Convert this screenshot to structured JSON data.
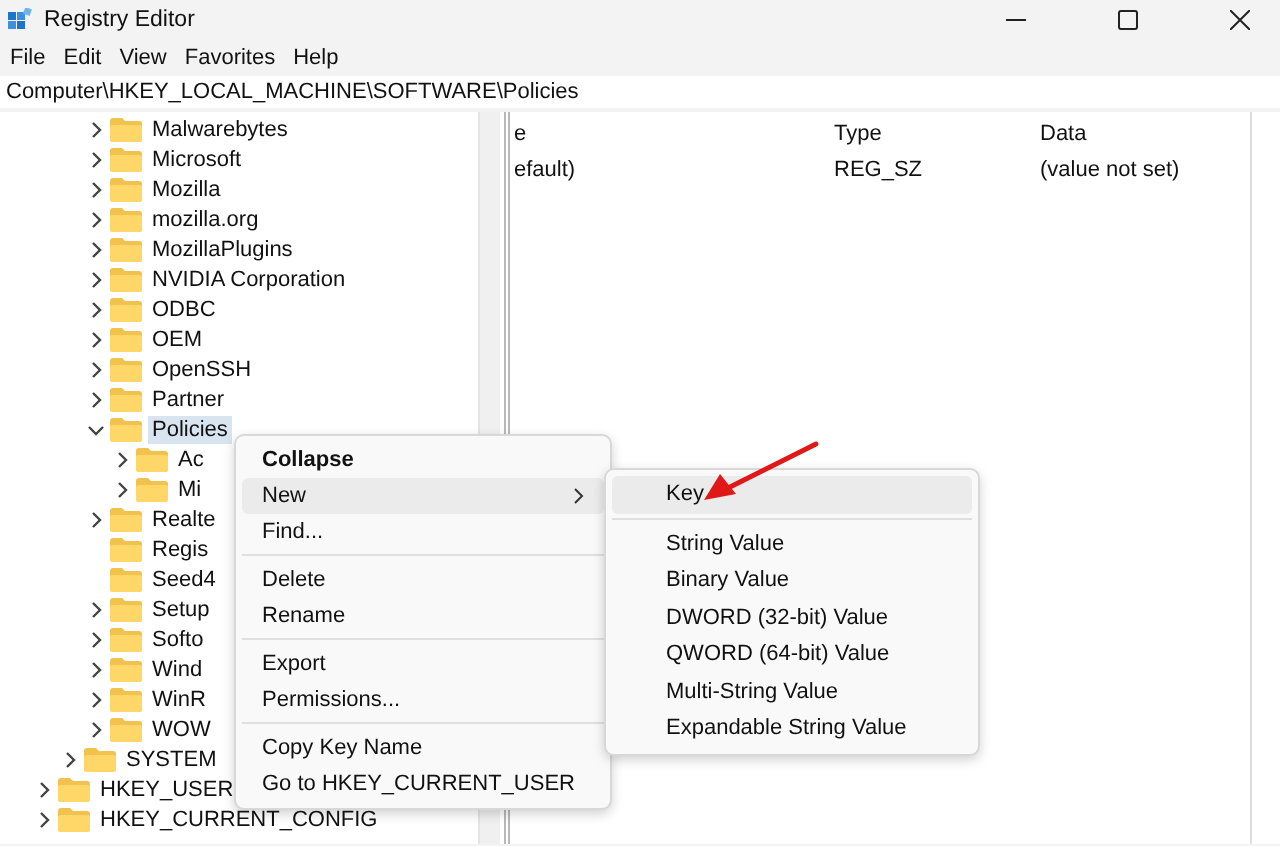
{
  "window": {
    "title": "Registry Editor"
  },
  "menu_bar": [
    "File",
    "Edit",
    "View",
    "Favorites",
    "Help"
  ],
  "address": "Computer\\HKEY_LOCAL_MACHINE\\SOFTWARE\\Policies",
  "tree": {
    "software_keys": [
      {
        "label": "Malwarebytes",
        "expanded": false,
        "leaf": false,
        "selected": false
      },
      {
        "label": "Microsoft",
        "expanded": false,
        "leaf": false,
        "selected": false
      },
      {
        "label": "Mozilla",
        "expanded": false,
        "leaf": false,
        "selected": false
      },
      {
        "label": "mozilla.org",
        "expanded": false,
        "leaf": false,
        "selected": false
      },
      {
        "label": "MozillaPlugins",
        "expanded": false,
        "leaf": false,
        "selected": false
      },
      {
        "label": "NVIDIA Corporation",
        "expanded": false,
        "leaf": false,
        "selected": false
      },
      {
        "label": "ODBC",
        "expanded": false,
        "leaf": false,
        "selected": false
      },
      {
        "label": "OEM",
        "expanded": false,
        "leaf": false,
        "selected": false
      },
      {
        "label": "OpenSSH",
        "expanded": false,
        "leaf": false,
        "selected": false
      },
      {
        "label": "Partner",
        "expanded": false,
        "leaf": false,
        "selected": false
      },
      {
        "label": "Policies",
        "expanded": true,
        "leaf": false,
        "selected": true,
        "children": [
          {
            "label": "Ac",
            "expanded": false,
            "leaf": false,
            "selected": false
          },
          {
            "label": "Mi",
            "expanded": false,
            "leaf": false,
            "selected": false
          }
        ]
      },
      {
        "label": "Realte",
        "expanded": false,
        "leaf": false,
        "selected": false
      },
      {
        "label": "Regis",
        "leaf": true,
        "selected": false
      },
      {
        "label": "Seed4",
        "leaf": true,
        "selected": false
      },
      {
        "label": "Setup",
        "expanded": false,
        "leaf": false,
        "selected": false
      },
      {
        "label": "Softo",
        "expanded": false,
        "leaf": false,
        "selected": false
      },
      {
        "label": "Wind",
        "expanded": false,
        "leaf": false,
        "selected": false
      },
      {
        "label": "WinR",
        "expanded": false,
        "leaf": false,
        "selected": false
      },
      {
        "label": "WOW",
        "expanded": false,
        "leaf": false,
        "selected": false
      }
    ],
    "machine_keys": [
      {
        "label": "SYSTEM",
        "expanded": false,
        "leaf": false,
        "selected": false
      }
    ],
    "hives": [
      {
        "label": "HKEY_USER",
        "expanded": false,
        "leaf": false,
        "selected": false
      },
      {
        "label": "HKEY_CURRENT_CONFIG",
        "expanded": false,
        "leaf": false,
        "selected": false
      }
    ]
  },
  "values": {
    "columns": [
      "e",
      "Type",
      "Data"
    ],
    "rows": [
      [
        "efault)",
        "REG_SZ",
        "(value not set)"
      ]
    ]
  },
  "context_menu": {
    "items": [
      {
        "kind": "item",
        "label": "Collapse",
        "default": true,
        "submenu": false,
        "selected": false
      },
      {
        "kind": "item",
        "label": "New",
        "default": false,
        "submenu": true,
        "selected": true
      },
      {
        "kind": "item",
        "label": "Find...",
        "default": false,
        "submenu": false,
        "selected": false
      },
      {
        "kind": "separator"
      },
      {
        "kind": "item",
        "label": "Delete",
        "default": false,
        "submenu": false,
        "selected": false
      },
      {
        "kind": "item",
        "label": "Rename",
        "default": false,
        "submenu": false,
        "selected": false
      },
      {
        "kind": "separator"
      },
      {
        "kind": "item",
        "label": "Export",
        "default": false,
        "submenu": false,
        "selected": false
      },
      {
        "kind": "item",
        "label": "Permissions...",
        "default": false,
        "submenu": false,
        "selected": false
      },
      {
        "kind": "separator"
      },
      {
        "kind": "item",
        "label": "Copy Key Name",
        "default": false,
        "submenu": false,
        "selected": false
      },
      {
        "kind": "item",
        "label": "Go to HKEY_CURRENT_USER",
        "default": false,
        "submenu": false,
        "selected": false
      }
    ]
  },
  "submenu": {
    "items": [
      {
        "kind": "item",
        "label": "Key",
        "selected": true
      },
      {
        "kind": "separator"
      },
      {
        "kind": "item",
        "label": "String Value",
        "selected": false
      },
      {
        "kind": "item",
        "label": "Binary Value",
        "selected": false
      },
      {
        "kind": "item",
        "label": "DWORD (32-bit) Value",
        "selected": false
      },
      {
        "kind": "item",
        "label": "QWORD (64-bit) Value",
        "selected": false
      },
      {
        "kind": "item",
        "label": "Multi-String Value",
        "selected": false
      },
      {
        "kind": "item",
        "label": "Expandable String Value",
        "selected": false
      }
    ]
  }
}
